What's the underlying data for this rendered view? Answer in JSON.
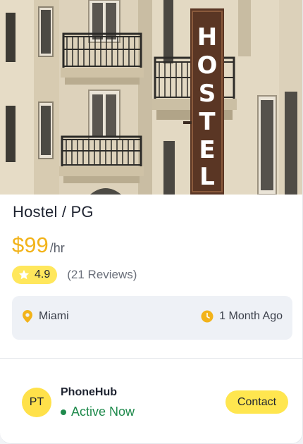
{
  "listing": {
    "hero_image_alt": "Hostel building facade with vertical HOSTEL sign",
    "sign_text": "HOSTEL",
    "title": "Hostel / PG",
    "price": "$99",
    "price_unit": "/hr",
    "rating": "4.9",
    "reviews": "(21 Reviews)",
    "location": "Miami",
    "posted": "1 Month Ago"
  },
  "seller": {
    "initials": "PT",
    "name": "PhoneHub",
    "status": "Active Now"
  },
  "actions": {
    "contact_label": "Contact"
  },
  "icons": {
    "rating": "star-icon",
    "location": "map-pin-icon",
    "time": "clock-icon",
    "status": "status-dot-icon"
  },
  "colors": {
    "accent": "#ffe64f",
    "price": "#f2b31a",
    "active": "#1f8a4c",
    "info_bg": "#eef1f6"
  }
}
